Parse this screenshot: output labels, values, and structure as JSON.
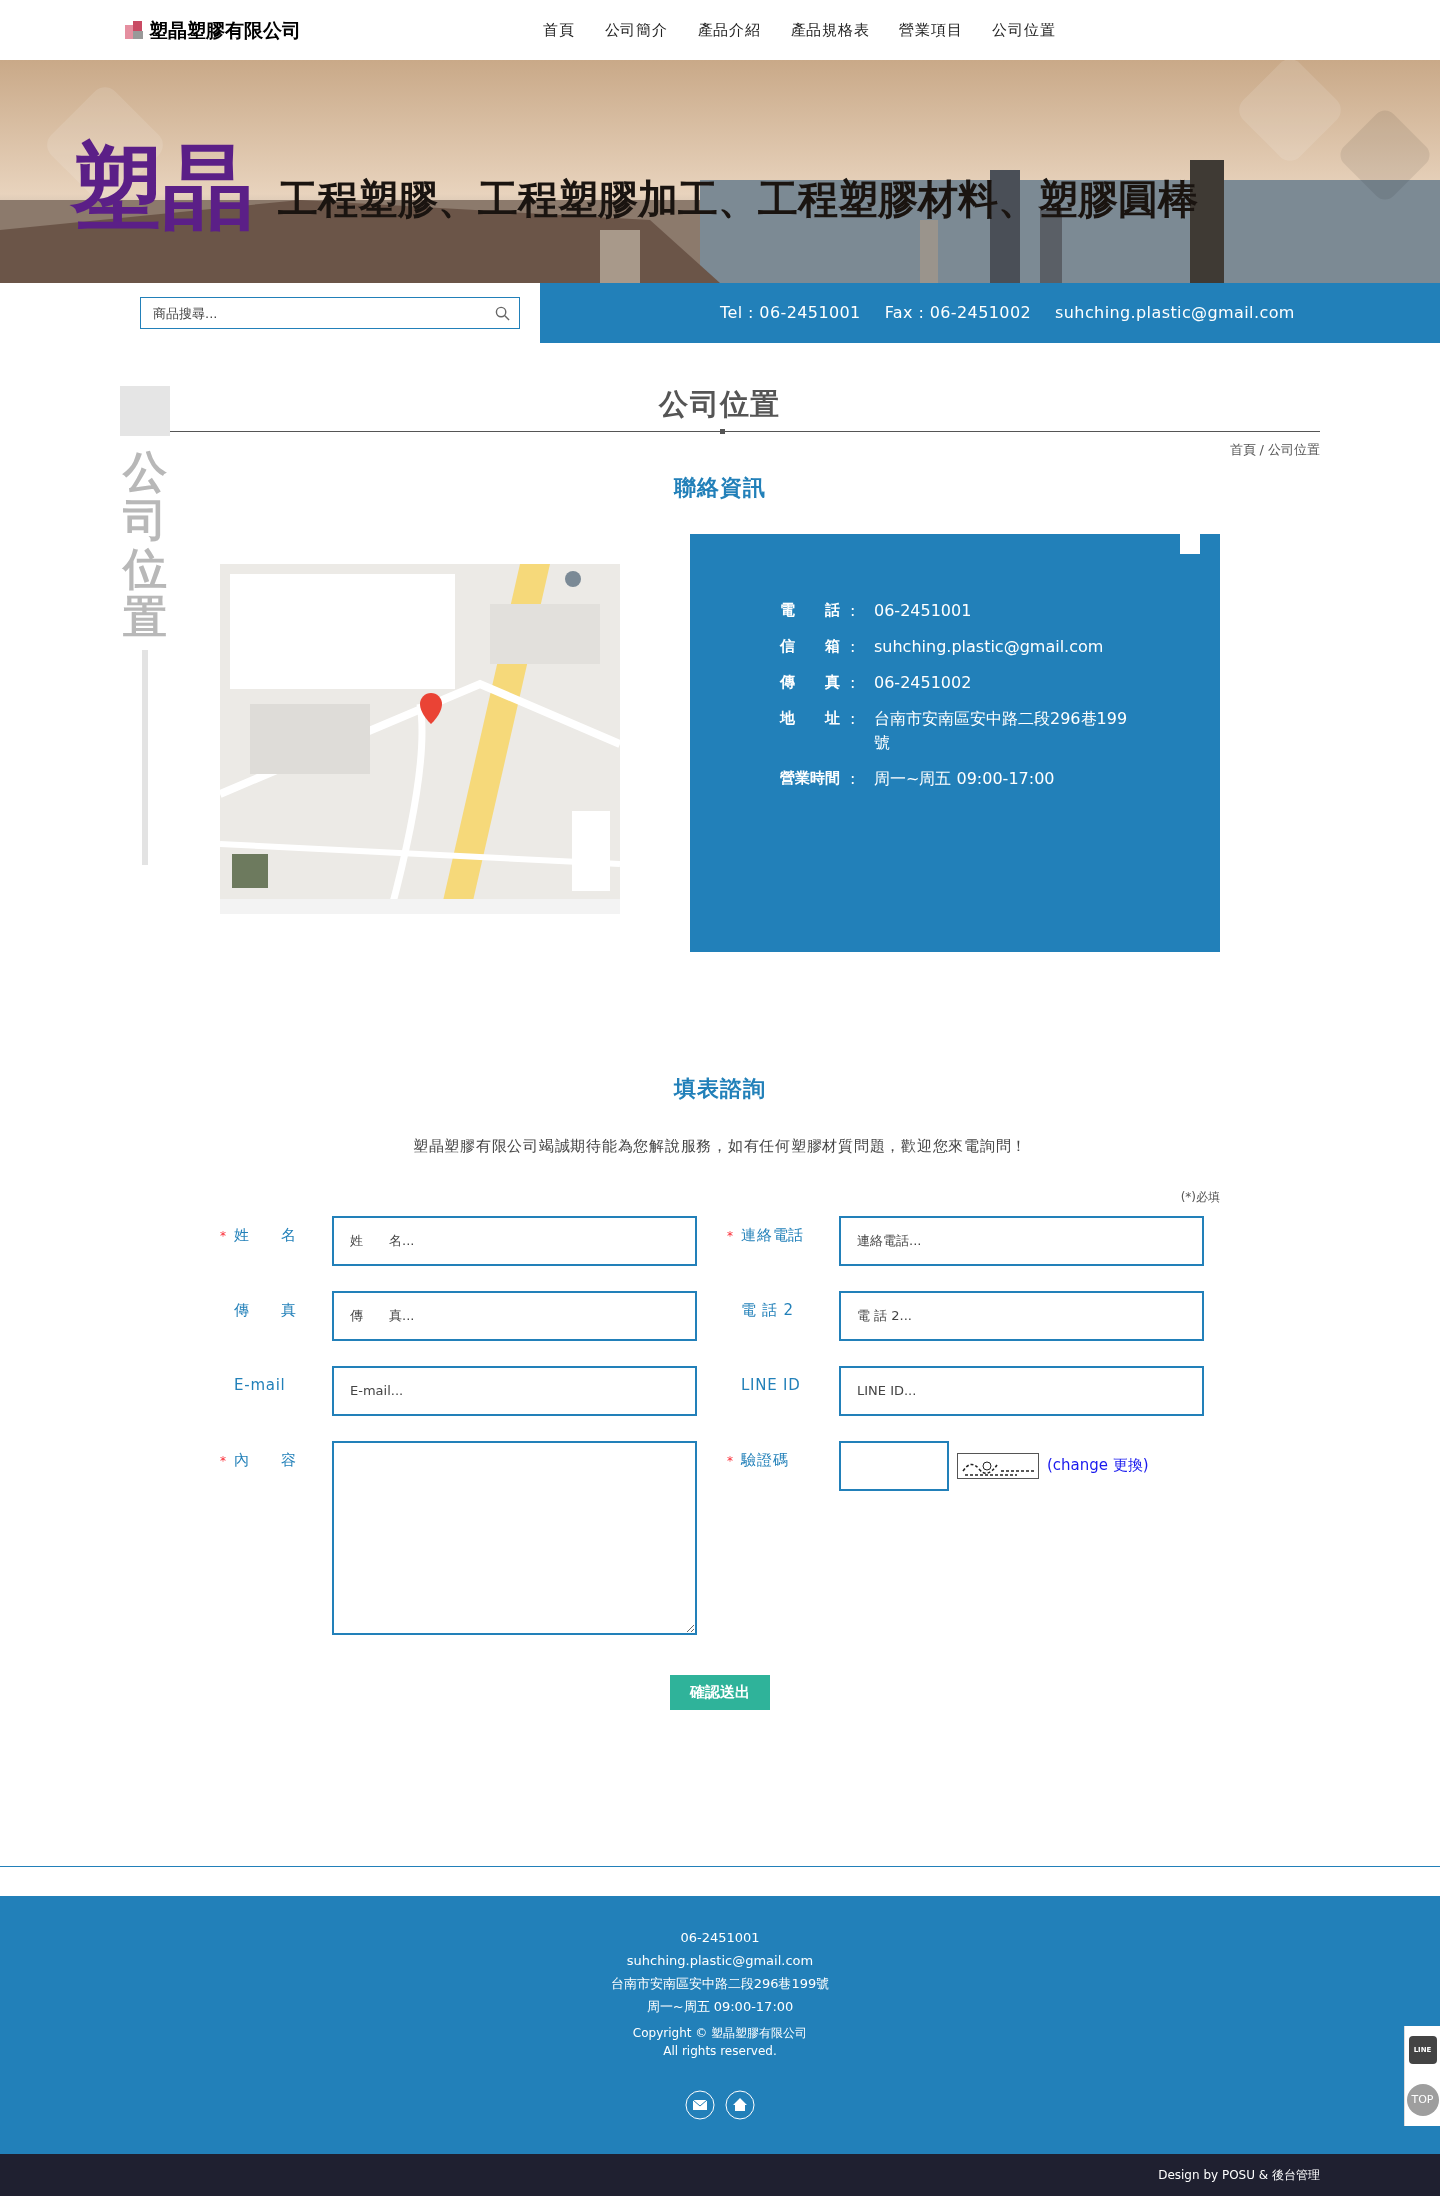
{
  "header": {
    "logo_text": "塑晶塑膠有限公司",
    "nav": [
      "首頁",
      "公司簡介",
      "產品介紹",
      "產品規格表",
      "營業項目",
      "公司位置"
    ]
  },
  "banner": {
    "brand": "塑晶",
    "slogan": "工程塑膠、工程塑膠加工、工程塑膠材料、塑膠圓棒"
  },
  "search": {
    "placeholder": "商品搜尋..."
  },
  "contact_bar": [
    "Tel : 06-2451001",
    "Fax : 06-2451002",
    "suhching.plastic@gmail.com"
  ],
  "page": {
    "title": "公司位置",
    "side_title": "公司位置",
    "breadcrumb": [
      "首頁",
      "公司位置"
    ],
    "breadcrumb_separator": "/"
  },
  "contact": {
    "heading": "聯絡資訊",
    "rows": [
      {
        "label": "電　　話",
        "sep": ":",
        "value": "06-2451001"
      },
      {
        "label": "信　　箱",
        "sep": ":",
        "value": "suhching.plastic@gmail.com"
      },
      {
        "label": "傳　　真",
        "sep": ":",
        "value": "06-2451002"
      },
      {
        "label": "地　　址",
        "sep": ":",
        "value": "台南市安南區安中路二段296巷199號"
      },
      {
        "label": "營業時間",
        "sep": ":",
        "value": "周一~周五 09:00-17:00"
      }
    ]
  },
  "form": {
    "heading": "填表諮詢",
    "intro": "塑晶塑膠有限公司竭誠期待能為您解說服務，如有任何塑膠材質問題，歡迎您來電詢問！",
    "required_note": "(*)必填",
    "fields": [
      {
        "kind": "input",
        "marker": "*",
        "label": "姓　　名",
        "placeholder": "姓　　名..."
      },
      {
        "kind": "input",
        "marker": "*",
        "label": "連絡電話",
        "placeholder": "連絡電話..."
      },
      {
        "kind": "input",
        "label": "傳　　真",
        "placeholder": "傳　　真..."
      },
      {
        "kind": "input",
        "label": "電 話 2",
        "placeholder": "電 話 2..."
      },
      {
        "kind": "input",
        "label": "E-mail",
        "placeholder": "E-mail..."
      },
      {
        "kind": "input",
        "label": "LINE ID",
        "placeholder": "LINE ID..."
      },
      {
        "kind": "textarea",
        "marker": "*",
        "label": "內　　容"
      },
      {
        "kind": "captcha",
        "marker": "*",
        "label": "驗證碼",
        "link": "(change 更換)"
      }
    ],
    "submit": "確認送出"
  },
  "footer": {
    "lines": [
      "06-2451001",
      "suhching.plastic@gmail.com",
      "台南市安南區安中路二段296巷199號",
      "周一~周五 09:00-17:00"
    ],
    "copyright": [
      "Copyright © 塑晶塑膠有限公司",
      "All rights reserved."
    ],
    "credit": "Design by POSU & 後台管理"
  },
  "side_widget": {
    "line": "LINE",
    "top": "TOP"
  }
}
